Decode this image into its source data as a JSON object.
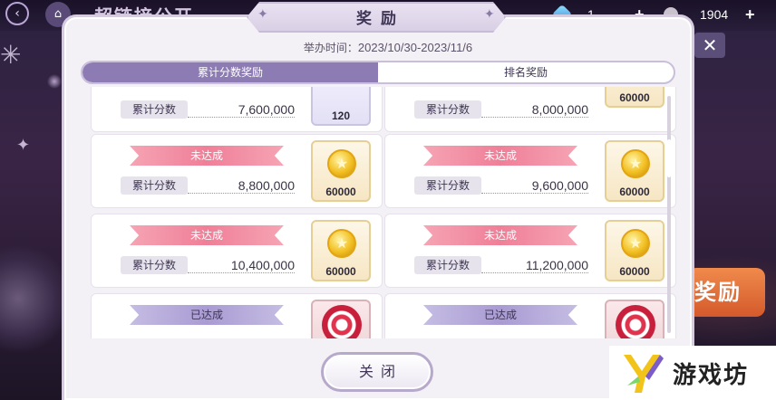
{
  "background": {
    "title": "超链接公开",
    "resource_1_value": "1",
    "resource_2_value": "1904",
    "plus": "+",
    "reward_button_label": "奖励"
  },
  "modal": {
    "title": "奖励",
    "period_label": "举办时间：",
    "period_value": "2023/10/30-2023/11/6",
    "tabs": [
      {
        "label": "累计分数奖励",
        "active": true
      },
      {
        "label": "排名奖励",
        "active": false
      }
    ],
    "score_label": "累计分数",
    "rewards": [
      {
        "status": "",
        "score": "7,600,000",
        "reward": "gem",
        "qty": "120"
      },
      {
        "status": "",
        "score": "8,000,000",
        "reward": "coin",
        "qty": "60000"
      },
      {
        "status": "未达成",
        "score": "8,800,000",
        "reward": "coin",
        "qty": "60000"
      },
      {
        "status": "未达成",
        "score": "9,600,000",
        "reward": "coin",
        "qty": "60000"
      },
      {
        "status": "未达成",
        "score": "10,400,000",
        "reward": "coin",
        "qty": "60000"
      },
      {
        "status": "未达成",
        "score": "11,200,000",
        "reward": "coin",
        "qty": "60000"
      },
      {
        "status": "已达成",
        "score": "",
        "reward": "item",
        "qty": ""
      },
      {
        "status": "已达成",
        "score": "",
        "reward": "item",
        "qty": ""
      }
    ],
    "close_label": "关闭"
  },
  "watermark": {
    "text": "游戏坊"
  }
}
